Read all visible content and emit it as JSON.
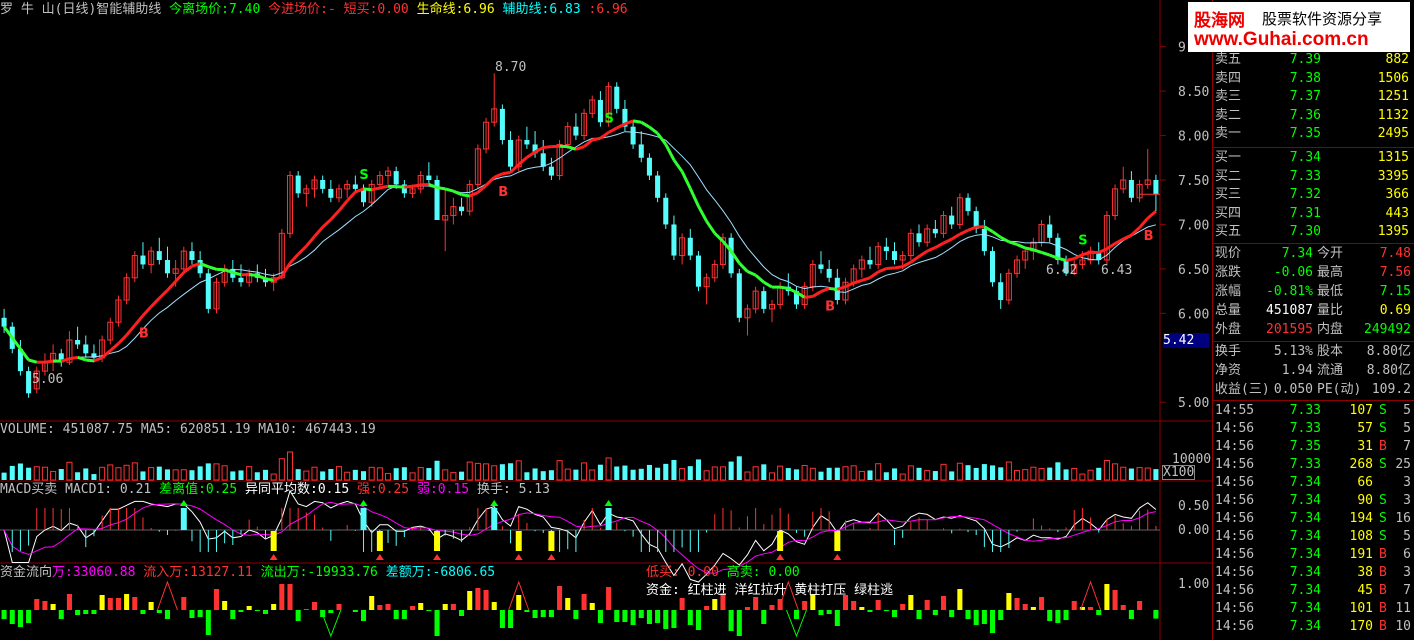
{
  "colors": {
    "up": "#ff3232",
    "down": "#54fcfc",
    "yellow": "#ffff00",
    "green": "#00ff00",
    "white": "#ffffff",
    "magenta": "#ff00ff",
    "frame": "#8b0000",
    "cyan": "#00c8c8"
  },
  "header": {
    "title": "罗 牛 山(日线)智能辅助线",
    "exit_label": "今离场价:",
    "exit_value": "7.40",
    "entry_label": "今进场价:",
    "entry_value": "-",
    "short_label": "短买:",
    "short_value": "0.00",
    "life_label": "生命线:",
    "life_value": "6.96",
    "aux_label": "辅助线:",
    "aux_value": "6.83",
    "aux2_value": "6.96"
  },
  "price_axis": {
    "ticks": [
      "9",
      "8.50",
      "8.00",
      "7.50",
      "7.00",
      "6.50",
      "6.00",
      "5.00"
    ],
    "current_tag": "5.42"
  },
  "annotations": {
    "high": "8.70",
    "low": "5.06",
    "low2": "6.42",
    "low3": "6.43",
    "buy": "B",
    "sell": "S"
  },
  "volume": {
    "label": "VOLUME: 451087.75 MA5: 620851.19 MA10: 467443.19",
    "tick": "10000",
    "unit": "X100"
  },
  "macd": {
    "title": "MACD买卖",
    "macd1": "MACD1: 0.21",
    "diff_label": "差离值:",
    "diff_value": "0.25",
    "avg_label": "异同平均数:",
    "avg_value": "0.15",
    "strong_label": "强:",
    "strong_value": "0.25",
    "weak_label": "弱:",
    "weak_value": "0.15",
    "turnover": "换手: 5.13",
    "ticks": [
      "0.50",
      "0.00"
    ]
  },
  "fund": {
    "title": "资金流向",
    "wan_label": "万:",
    "wan_value": "33060.88",
    "in_label": "流入万:",
    "in_value": "13127.11",
    "out_label": "流出万:",
    "out_value": "-19933.76",
    "diff_label": "差额万:",
    "diff_value": "-6806.65",
    "low_buy": "低买: 0.00",
    "high_sell": "高卖: 0.00",
    "legend": "资金: 红柱进 洋红拉升 黄柱打压 绿柱逃",
    "tick": "1.00"
  },
  "ad": {
    "brand": "股海网",
    "slogan": "股票软件资源分享",
    "url": "www.Guhai.com.cn"
  },
  "quote": {
    "asks": [
      {
        "label": "卖五",
        "price": "7.39",
        "vol": "882"
      },
      {
        "label": "卖四",
        "price": "7.38",
        "vol": "1506"
      },
      {
        "label": "卖三",
        "price": "7.37",
        "vol": "1251"
      },
      {
        "label": "卖二",
        "price": "7.36",
        "vol": "1132"
      },
      {
        "label": "卖一",
        "price": "7.35",
        "vol": "2495"
      }
    ],
    "bids": [
      {
        "label": "买一",
        "price": "7.34",
        "vol": "1315"
      },
      {
        "label": "买二",
        "price": "7.33",
        "vol": "3395"
      },
      {
        "label": "买三",
        "price": "7.32",
        "vol": "366"
      },
      {
        "label": "买四",
        "price": "7.31",
        "vol": "443"
      },
      {
        "label": "买五",
        "price": "7.30",
        "vol": "1395"
      }
    ],
    "stats": [
      {
        "l1": "现价",
        "v1": "7.34",
        "l2": "今开",
        "v2": "7.48",
        "c1": "green",
        "c2": "red"
      },
      {
        "l1": "涨跌",
        "v1": "-0.06",
        "l2": "最高",
        "v2": "7.56",
        "c1": "green",
        "c2": "red"
      },
      {
        "l1": "涨幅",
        "v1": "-0.81%",
        "l2": "最低",
        "v2": "7.15",
        "c1": "green",
        "c2": "green"
      },
      {
        "l1": "总量",
        "v1": "451087",
        "l2": "量比",
        "v2": "0.69",
        "c1": "white",
        "c2": "yellow"
      },
      {
        "l1": "外盘",
        "v1": "201595",
        "l2": "内盘",
        "v2": "249492",
        "c1": "red",
        "c2": "green"
      }
    ],
    "stats2": [
      {
        "l1": "换手",
        "v1": "5.13%",
        "l2": "股本",
        "v2": "8.80亿"
      },
      {
        "l1": "净资",
        "v1": "1.94",
        "l2": "流通",
        "v2": "8.80亿"
      },
      {
        "l1": "收益(三)",
        "v1": "0.050",
        "l2": "PE(动)",
        "v2": "109.2"
      }
    ],
    "ticks": [
      {
        "time": "14:55",
        "price": "7.33",
        "vol": "107",
        "side": "S",
        "n": "5"
      },
      {
        "time": "14:56",
        "price": "7.33",
        "vol": "57",
        "side": "S",
        "n": "5"
      },
      {
        "time": "14:56",
        "price": "7.35",
        "vol": "31",
        "side": "B",
        "n": "7"
      },
      {
        "time": "14:56",
        "price": "7.33",
        "vol": "268",
        "side": "S",
        "n": "25"
      },
      {
        "time": "14:56",
        "price": "7.34",
        "vol": "66",
        "side": "",
        "n": "3"
      },
      {
        "time": "14:56",
        "price": "7.34",
        "vol": "90",
        "side": "S",
        "n": "3"
      },
      {
        "time": "14:56",
        "price": "7.34",
        "vol": "194",
        "side": "S",
        "n": "16"
      },
      {
        "time": "14:56",
        "price": "7.34",
        "vol": "108",
        "side": "S",
        "n": "5"
      },
      {
        "time": "14:56",
        "price": "7.34",
        "vol": "191",
        "side": "B",
        "n": "6"
      },
      {
        "time": "14:56",
        "price": "7.34",
        "vol": "38",
        "side": "B",
        "n": "3"
      },
      {
        "time": "14:56",
        "price": "7.34",
        "vol": "45",
        "side": "B",
        "n": "7"
      },
      {
        "time": "14:56",
        "price": "7.34",
        "vol": "101",
        "side": "B",
        "n": "11"
      },
      {
        "time": "14:56",
        "price": "7.34",
        "vol": "170",
        "side": "B",
        "n": "10"
      }
    ]
  },
  "chart_data": {
    "type": "candlestick",
    "price_range": [
      4.8,
      9.3
    ],
    "ohlc": [
      [
        5.95,
        6.05,
        5.78,
        5.85
      ],
      [
        5.85,
        5.9,
        5.55,
        5.6
      ],
      [
        5.6,
        5.7,
        5.3,
        5.35
      ],
      [
        5.35,
        5.4,
        5.05,
        5.1
      ],
      [
        5.15,
        5.4,
        5.1,
        5.35
      ],
      [
        5.35,
        5.55,
        5.3,
        5.45
      ],
      [
        5.45,
        5.65,
        5.35,
        5.55
      ],
      [
        5.55,
        5.6,
        5.4,
        5.45
      ],
      [
        5.45,
        5.8,
        5.42,
        5.7
      ],
      [
        5.7,
        5.85,
        5.6,
        5.65
      ],
      [
        5.65,
        5.75,
        5.5,
        5.55
      ],
      [
        5.55,
        5.65,
        5.45,
        5.5
      ],
      [
        5.5,
        5.75,
        5.45,
        5.7
      ],
      [
        5.7,
        5.95,
        5.65,
        5.9
      ],
      [
        5.9,
        6.2,
        5.85,
        6.15
      ],
      [
        6.15,
        6.45,
        6.1,
        6.4
      ],
      [
        6.4,
        6.7,
        6.35,
        6.65
      ],
      [
        6.65,
        6.8,
        6.5,
        6.55
      ],
      [
        6.55,
        6.75,
        6.45,
        6.7
      ],
      [
        6.7,
        6.85,
        6.55,
        6.6
      ],
      [
        6.6,
        6.75,
        6.4,
        6.45
      ],
      [
        6.45,
        6.6,
        6.3,
        6.5
      ],
      [
        6.5,
        6.75,
        6.45,
        6.7
      ],
      [
        6.7,
        6.8,
        6.55,
        6.6
      ],
      [
        6.6,
        6.7,
        6.4,
        6.45
      ],
      [
        6.45,
        6.5,
        6.0,
        6.05
      ],
      [
        6.05,
        6.4,
        6.0,
        6.35
      ],
      [
        6.35,
        6.55,
        6.3,
        6.5
      ],
      [
        6.5,
        6.6,
        6.35,
        6.4
      ],
      [
        6.4,
        6.55,
        6.3,
        6.35
      ],
      [
        6.35,
        6.5,
        6.3,
        6.45
      ],
      [
        6.45,
        6.55,
        6.35,
        6.4
      ],
      [
        6.4,
        6.5,
        6.3,
        6.35
      ],
      [
        6.35,
        6.45,
        6.25,
        6.4
      ],
      [
        6.4,
        6.95,
        6.38,
        6.9
      ],
      [
        6.9,
        7.6,
        6.85,
        7.55
      ],
      [
        7.55,
        7.6,
        7.3,
        7.35
      ],
      [
        7.35,
        7.45,
        7.2,
        7.4
      ],
      [
        7.4,
        7.55,
        7.3,
        7.5
      ],
      [
        7.5,
        7.55,
        7.35,
        7.4
      ],
      [
        7.4,
        7.5,
        7.25,
        7.3
      ],
      [
        7.3,
        7.45,
        7.25,
        7.4
      ],
      [
        7.4,
        7.5,
        7.3,
        7.45
      ],
      [
        7.45,
        7.55,
        7.35,
        7.4
      ],
      [
        7.4,
        7.45,
        7.2,
        7.25
      ],
      [
        7.25,
        7.5,
        7.2,
        7.45
      ],
      [
        7.45,
        7.6,
        7.4,
        7.55
      ],
      [
        7.55,
        7.65,
        7.45,
        7.6
      ],
      [
        7.6,
        7.65,
        7.4,
        7.45
      ],
      [
        7.45,
        7.5,
        7.3,
        7.35
      ],
      [
        7.35,
        7.45,
        7.3,
        7.4
      ],
      [
        7.4,
        7.6,
        7.35,
        7.55
      ],
      [
        7.55,
        7.7,
        7.45,
        7.5
      ],
      [
        7.5,
        7.55,
        7.1,
        7.05
      ],
      [
        7.05,
        7.4,
        6.7,
        7.1
      ],
      [
        7.1,
        7.3,
        7.0,
        7.2
      ],
      [
        7.2,
        7.3,
        7.1,
        7.15
      ],
      [
        7.15,
        7.5,
        7.1,
        7.45
      ],
      [
        7.45,
        7.9,
        7.4,
        7.85
      ],
      [
        7.85,
        8.2,
        7.8,
        8.15
      ],
      [
        8.15,
        8.7,
        8.1,
        8.3
      ],
      [
        8.3,
        8.35,
        7.9,
        7.95
      ],
      [
        7.95,
        8.05,
        7.6,
        7.65
      ],
      [
        7.65,
        8.0,
        7.6,
        7.95
      ],
      [
        7.95,
        8.1,
        7.85,
        7.9
      ],
      [
        7.9,
        8.05,
        7.75,
        7.8
      ],
      [
        7.8,
        7.95,
        7.6,
        7.65
      ],
      [
        7.65,
        7.75,
        7.5,
        7.55
      ],
      [
        7.55,
        7.95,
        7.5,
        7.9
      ],
      [
        7.9,
        8.15,
        7.85,
        8.1
      ],
      [
        8.1,
        8.25,
        7.95,
        8.0
      ],
      [
        8.0,
        8.3,
        7.95,
        8.25
      ],
      [
        8.25,
        8.45,
        8.2,
        8.4
      ],
      [
        8.4,
        8.5,
        8.1,
        8.15
      ],
      [
        8.15,
        8.6,
        8.1,
        8.55
      ],
      [
        8.55,
        8.6,
        8.25,
        8.3
      ],
      [
        8.3,
        8.4,
        8.05,
        8.1
      ],
      [
        8.1,
        8.15,
        7.85,
        7.9
      ],
      [
        7.9,
        8.05,
        7.7,
        7.75
      ],
      [
        7.75,
        7.8,
        7.5,
        7.55
      ],
      [
        7.55,
        7.6,
        7.25,
        7.3
      ],
      [
        7.3,
        7.35,
        6.95,
        7.0
      ],
      [
        7.0,
        7.1,
        6.6,
        6.65
      ],
      [
        6.65,
        6.9,
        6.55,
        6.85
      ],
      [
        6.85,
        6.95,
        6.6,
        6.65
      ],
      [
        6.65,
        6.7,
        6.25,
        6.3
      ],
      [
        6.3,
        6.45,
        6.1,
        6.4
      ],
      [
        6.4,
        6.6,
        6.35,
        6.55
      ],
      [
        6.55,
        6.9,
        6.5,
        6.85
      ],
      [
        6.85,
        6.9,
        6.4,
        6.45
      ],
      [
        6.45,
        6.5,
        5.9,
        5.95
      ],
      [
        5.95,
        6.1,
        5.75,
        6.05
      ],
      [
        6.05,
        6.3,
        6.0,
        6.25
      ],
      [
        6.25,
        6.3,
        6.0,
        6.05
      ],
      [
        6.05,
        6.15,
        5.9,
        6.1
      ],
      [
        6.1,
        6.35,
        6.05,
        6.3
      ],
      [
        6.3,
        6.45,
        6.2,
        6.25
      ],
      [
        6.25,
        6.3,
        6.05,
        6.1
      ],
      [
        6.1,
        6.35,
        6.05,
        6.3
      ],
      [
        6.3,
        6.6,
        6.25,
        6.55
      ],
      [
        6.55,
        6.7,
        6.45,
        6.5
      ],
      [
        6.5,
        6.6,
        6.35,
        6.4
      ],
      [
        6.4,
        6.5,
        6.1,
        6.15
      ],
      [
        6.15,
        6.4,
        6.1,
        6.35
      ],
      [
        6.35,
        6.55,
        6.3,
        6.5
      ],
      [
        6.5,
        6.65,
        6.4,
        6.6
      ],
      [
        6.6,
        6.75,
        6.5,
        6.55
      ],
      [
        6.55,
        6.8,
        6.5,
        6.75
      ],
      [
        6.75,
        6.85,
        6.6,
        6.7
      ],
      [
        6.7,
        6.8,
        6.55,
        6.6
      ],
      [
        6.6,
        6.7,
        6.5,
        6.65
      ],
      [
        6.65,
        6.95,
        6.6,
        6.9
      ],
      [
        6.9,
        7.0,
        6.75,
        6.8
      ],
      [
        6.8,
        7.0,
        6.75,
        6.95
      ],
      [
        6.95,
        7.05,
        6.85,
        6.9
      ],
      [
        6.9,
        7.15,
        6.85,
        7.1
      ],
      [
        7.1,
        7.2,
        6.95,
        7.0
      ],
      [
        7.0,
        7.35,
        6.95,
        7.3
      ],
      [
        7.3,
        7.35,
        7.1,
        7.15
      ],
      [
        7.15,
        7.2,
        6.9,
        6.95
      ],
      [
        6.95,
        7.05,
        6.65,
        6.7
      ],
      [
        6.7,
        6.75,
        6.3,
        6.35
      ],
      [
        6.35,
        6.45,
        6.05,
        6.15
      ],
      [
        6.15,
        6.5,
        6.1,
        6.45
      ],
      [
        6.45,
        6.65,
        6.4,
        6.6
      ],
      [
        6.6,
        6.75,
        6.5,
        6.7
      ],
      [
        6.7,
        6.85,
        6.6,
        6.8
      ],
      [
        6.8,
        7.05,
        6.75,
        7.0
      ],
      [
        7.0,
        7.1,
        6.8,
        6.85
      ],
      [
        6.85,
        6.9,
        6.55,
        6.6
      ],
      [
        6.6,
        6.65,
        6.42,
        6.45
      ],
      [
        6.45,
        6.6,
        6.43,
        6.55
      ],
      [
        6.55,
        6.7,
        6.5,
        6.6
      ],
      [
        6.6,
        6.75,
        6.55,
        6.7
      ],
      [
        6.7,
        6.8,
        6.55,
        6.6
      ],
      [
        6.6,
        7.15,
        6.55,
        7.1
      ],
      [
        7.1,
        7.45,
        7.05,
        7.4
      ],
      [
        7.4,
        7.65,
        7.35,
        7.5
      ],
      [
        7.5,
        7.6,
        7.25,
        7.3
      ],
      [
        7.3,
        7.5,
        7.25,
        7.45
      ],
      [
        7.45,
        7.85,
        7.4,
        7.5
      ],
      [
        7.5,
        7.56,
        7.15,
        7.34
      ]
    ]
  }
}
